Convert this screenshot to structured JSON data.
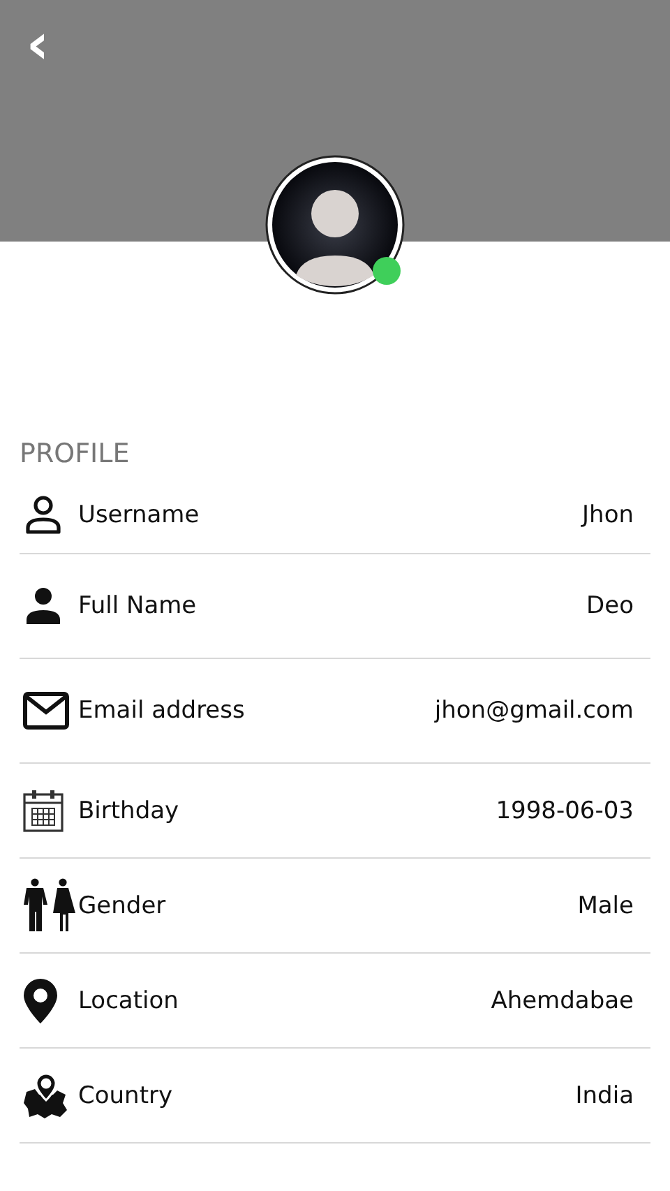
{
  "header": {
    "back": "‹"
  },
  "avatar": {
    "online": true
  },
  "section_title": "PROFILE",
  "rows": [
    {
      "kind": "username",
      "label": "Username",
      "value": "Jhon"
    },
    {
      "kind": "fullname",
      "label": "Full Name",
      "value": "Deo"
    },
    {
      "kind": "email",
      "label": "Email address",
      "value": "jhon@gmail.com"
    },
    {
      "kind": "birthday",
      "label": "Birthday",
      "value": "1998-06-03"
    },
    {
      "kind": "gender",
      "label": "Gender",
      "value": "Male"
    },
    {
      "kind": "location",
      "label": "Location",
      "value": "Ahemdabae"
    },
    {
      "kind": "country",
      "label": "Country",
      "value": "India"
    }
  ]
}
